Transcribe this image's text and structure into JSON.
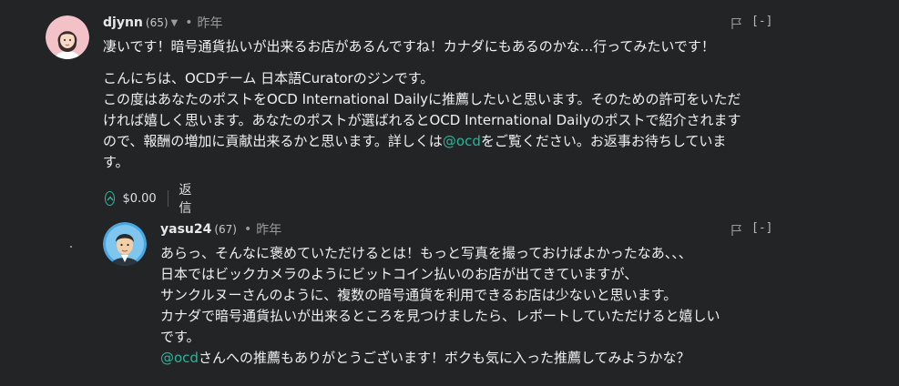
{
  "comment1": {
    "author": "djynn",
    "reputation": "(65)",
    "time_sep": "•",
    "time": "昨年",
    "collapse_label": "[-]",
    "body": [
      "凄いです！暗号通貨払いが出来るお店があるんですね！カナダにもあるのかな...行ってみたいです！"
    ],
    "reply_to_comment": {
      "lines": [
        "こんにちは、OCDチーム 日本語Curatorのジンです。",
        "この度はあなたのポストをOCD International Dailyに推薦したいと思います。そのための許可をいただ",
        "ければ嬉しく思います。あなたのポストが選ばれるとOCD International Dailyのポストで紹介されます",
        "ので、報酬の増加に貢献出来るかと思います。詳しくは"
      ],
      "mention": "@ocd",
      "after_mention": "をご覧ください。お返事お待ちしていま",
      "last": "す。"
    },
    "payout": "$0.00",
    "reply_label": "返信"
  },
  "comment2": {
    "author": "yasu24",
    "reputation": "(67)",
    "time_sep": "•",
    "time": "昨年",
    "collapse_label": "[-]",
    "lines": [
      "あらっ、そんなに褒めていただけるとは！もっと写真を撮っておけばよかったなあ、、、",
      "日本ではビックカメラのようにビットコイン払いのお店が出てきていますが、",
      "サンクルヌーさんのように、複数の暗号通貨を利用できるお店は少ないと思います。",
      "カナダで暗号通貨払いが出来るところを見つけましたら、レポートしていただけると嬉しい",
      "です。"
    ],
    "mention": "@ocd",
    "after_mention": "さんへの推薦もありがとうございます！ボクも気に入った推薦してみようかな？"
  },
  "colors": {
    "background": "#222426",
    "accent": "#2bb59a",
    "muted": "#9a9a9a"
  },
  "icons": {
    "flag": "flag-icon",
    "caret": "chevron-down-icon",
    "upvote": "upvote-icon"
  }
}
